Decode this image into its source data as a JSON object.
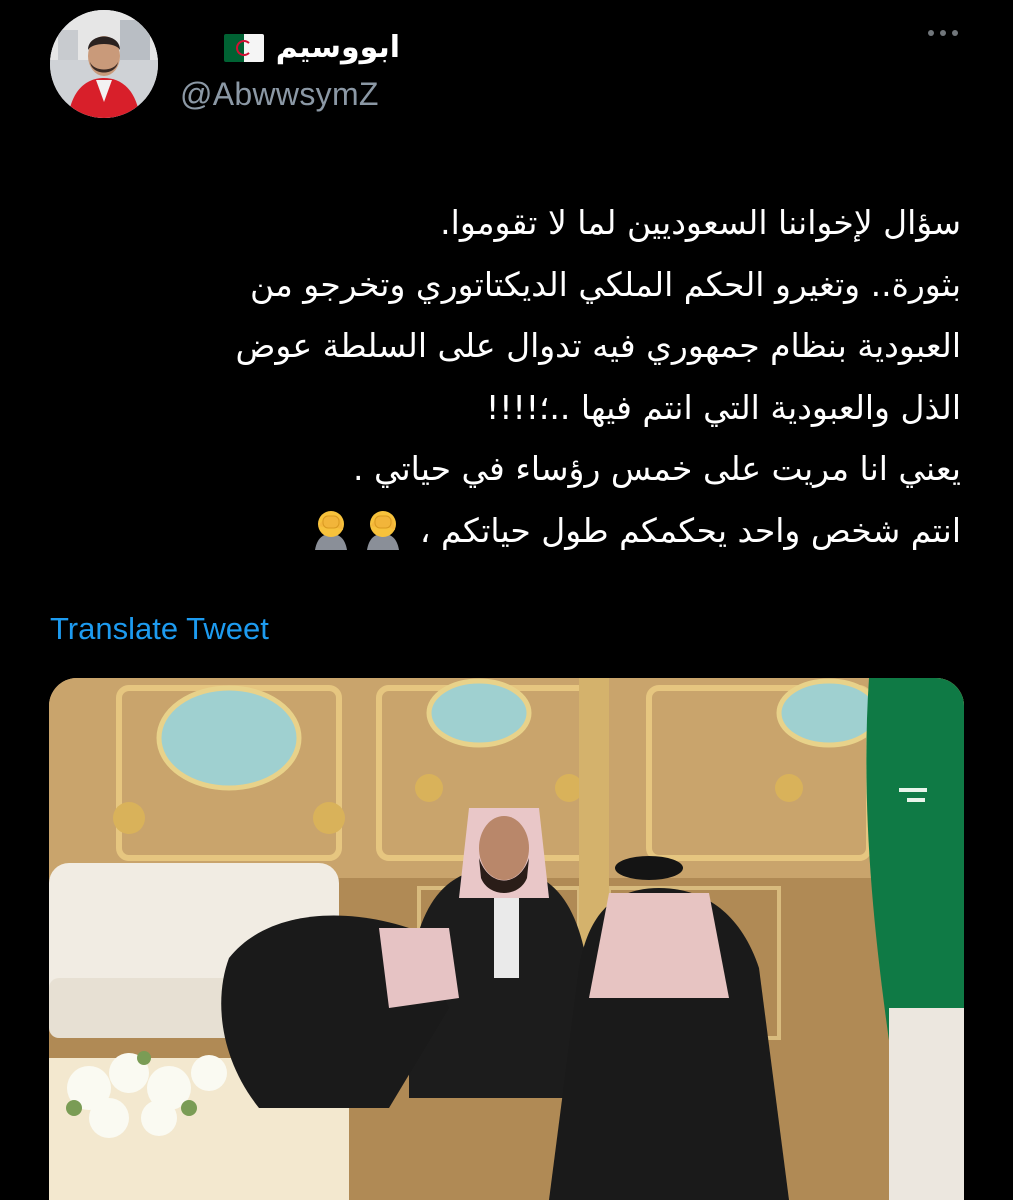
{
  "author": {
    "display_name": "ابووسيم",
    "flag": "Algeria flag",
    "handle": "@AbwwsymZ",
    "avatar": "profile photo of man in red jacket"
  },
  "tweet": {
    "lines": [
      "سؤال لإخواننا السعوديين لما لا تقوموا.",
      "بثورة.. وتغيرو الحكم الملكي الديكتاتوري وتخرجو من",
      "العبودية بنظام جمهوري فيه تدوال على السلطة عوض",
      "الذل والعبودية التي انتم فيها ..؛!!!!",
      "يعني انا مريت على خمس رؤساء في حياتي .",
      "انتم شخص واحد يحكمكم طول حياتكم ،"
    ],
    "emoji": "face-palm-emoji"
  },
  "actions": {
    "translate_label": "Translate Tweet",
    "more_icon": "more-options-icon"
  },
  "colors": {
    "background": "#000000",
    "text": "#ffffff",
    "secondary": "#8b98a5",
    "link": "#1d9bf0"
  },
  "media": {
    "description_icon": "attached-photo"
  }
}
